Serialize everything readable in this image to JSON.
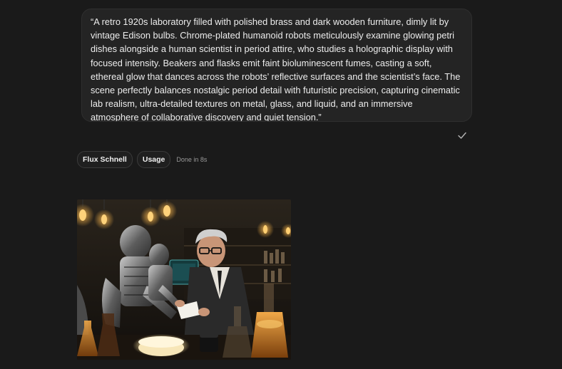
{
  "prompt": {
    "text": "“A retro 1920s laboratory filled with polished brass and dark wooden furniture, dimly lit by vintage Edison bulbs. Chrome-plated humanoid robots meticulously examine glowing petri dishes alongside a human scientist in period attire, who studies a holographic display with focused intensity. Beakers and flasks emit faint bioluminescent fumes, casting a soft, ethereal glow that dances across the robots’ reflective surfaces and the scientist’s face. The scene perfectly balances nostalgic period detail with futuristic precision, capturing cinematic lab realism, ultra-detailed textures on metal, glass, and liquid, and an immersive atmosphere of collaborative discovery and quiet tension.”"
  },
  "status_icon": "check-icon",
  "chips": {
    "model_label": "Flux Schnell",
    "usage_label": "Usage",
    "status_text": "Done in 8s"
  },
  "generated_image": {
    "subject": "generated-image",
    "palette": {
      "background": "#1b1814",
      "bulb_glow": "#f2b14a",
      "robot_metal": "#8c8c8c",
      "coat": "#2a2a2a",
      "amber_liquid": "#c87a1e",
      "petri_glow": "#fff1c9"
    }
  }
}
